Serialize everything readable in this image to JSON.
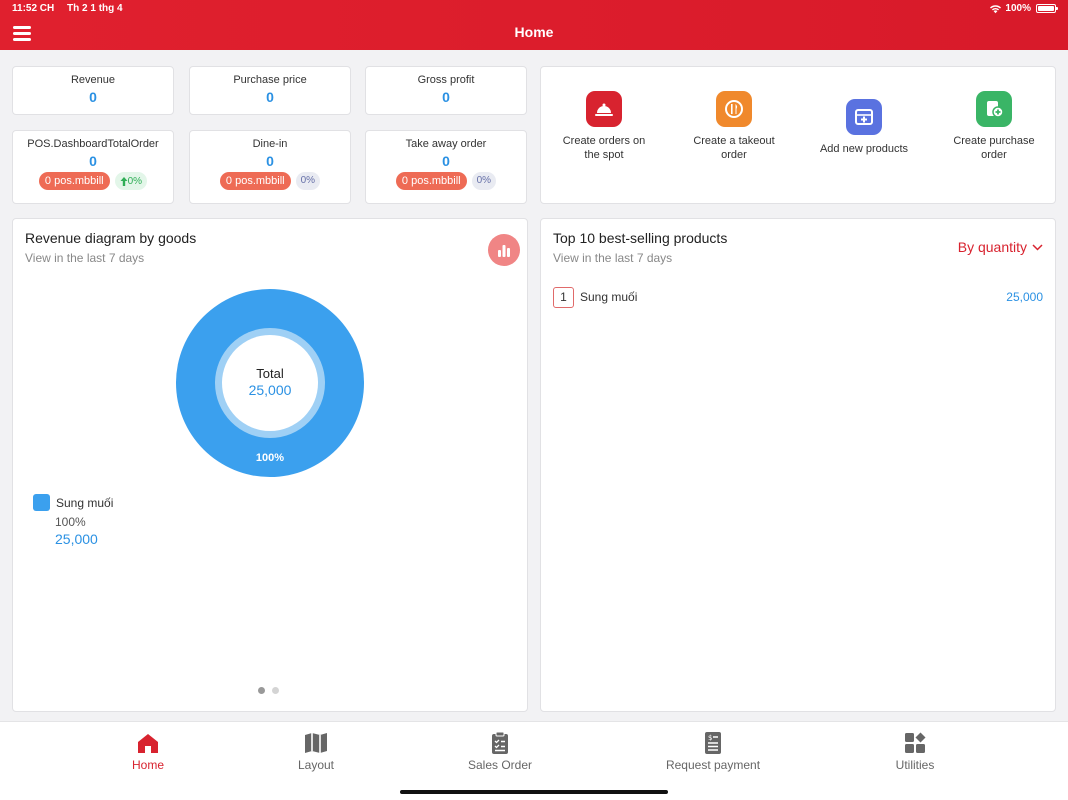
{
  "status_bar": {
    "time": "11:52 CH",
    "date": "Th 2 1 thg 4",
    "battery": "100%"
  },
  "header": {
    "title": "Home"
  },
  "stats": {
    "revenue": {
      "label": "Revenue",
      "value": "0"
    },
    "purchase_price": {
      "label": "Purchase price",
      "value": "0"
    },
    "gross_profit": {
      "label": "Gross profit",
      "value": "0"
    },
    "total_order": {
      "label": "POS.DashboardTotalOrder",
      "value": "0",
      "bill": "0 pos.mbbill",
      "change": "0%"
    },
    "dine_in": {
      "label": "Dine-in",
      "value": "0",
      "bill": "0 pos.mbbill",
      "change": "0%"
    },
    "take_away": {
      "label": "Take away order",
      "value": "0",
      "bill": "0 pos.mbbill",
      "change": "0%"
    }
  },
  "quick_actions": [
    {
      "label": "Create orders on the spot",
      "icon": "serving-dish-icon",
      "color": "#d8232f"
    },
    {
      "label": "Create a takeout order",
      "icon": "takeout-cutlery-icon",
      "color": "#f0892c"
    },
    {
      "label": "Add new products",
      "icon": "add-product-box-icon",
      "color": "#5a72e0"
    },
    {
      "label": "Create purchase order",
      "icon": "purchase-order-icon",
      "color": "#3ab566"
    }
  ],
  "revenue_panel": {
    "title": "Revenue diagram by goods",
    "subtitle": "View in the last 7 days",
    "center_label": "Total",
    "center_value": "25,000"
  },
  "chart_data": {
    "type": "pie",
    "categories": [
      "Sung muối"
    ],
    "values": [
      100
    ],
    "slice_labels": [
      "100%"
    ],
    "legend": [
      {
        "name": "Sung muối",
        "percent": "100%",
        "value": "25,000",
        "color": "#3ba0ee"
      }
    ],
    "total": {
      "label": "Total",
      "value": "25,000"
    }
  },
  "top_products": {
    "title": "Top 10 best-selling products",
    "subtitle": "View in the last 7 days",
    "sort_label": "By quantity",
    "items": [
      {
        "rank": "1",
        "name": "Sung muối",
        "value": "25,000"
      }
    ]
  },
  "nav": {
    "home": "Home",
    "layout": "Layout",
    "sales_order": "Sales Order",
    "request_payment": "Request payment",
    "utilities": "Utilities",
    "active_color": "#d8232f"
  }
}
